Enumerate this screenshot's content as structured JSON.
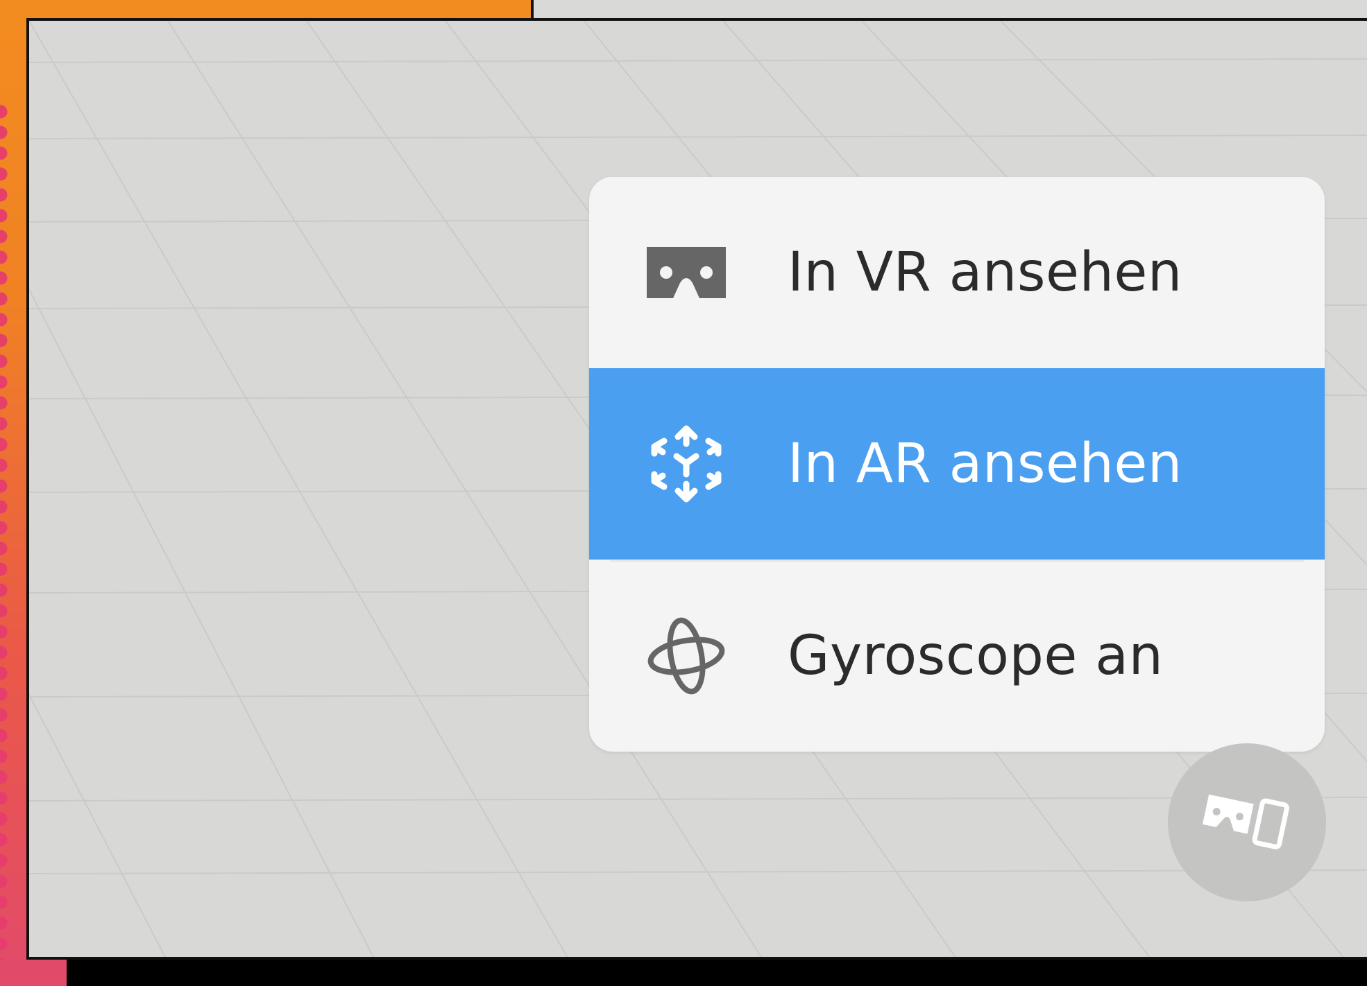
{
  "menu": {
    "items": [
      {
        "label": "In VR ansehen",
        "icon": "vr-headset-icon",
        "selected": false
      },
      {
        "label": "In AR ansehen",
        "icon": "ar-cube-icon",
        "selected": true
      },
      {
        "label": "Gyroscope an",
        "icon": "gyroscope-icon",
        "selected": false
      }
    ]
  },
  "fab": {
    "icon": "vr-ar-toggle-icon"
  },
  "colors": {
    "selected_bg": "#4a9ff0",
    "menu_bg": "#f4f4f4",
    "viewport_bg": "#d8d9d7",
    "fab_bg": "#c4c5c3",
    "icon_dark": "#666666",
    "accent_orange": "#f28c20",
    "accent_pink": "#e24a6a"
  }
}
